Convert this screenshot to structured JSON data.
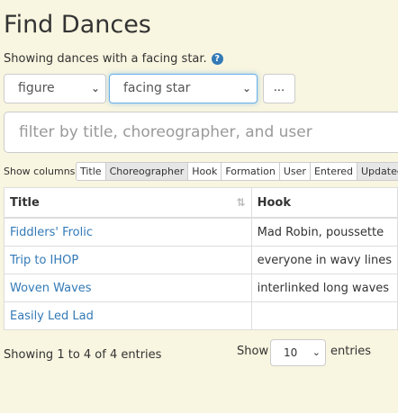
{
  "page": {
    "title": "Find Dances",
    "subtitle": "Showing dances with a facing star.",
    "help_glyph": "?"
  },
  "filter_row": {
    "field_select": "figure",
    "value_select": "facing star",
    "more_button": "..."
  },
  "search": {
    "placeholder": "filter by title, choreographer, and user"
  },
  "columns_toggle": {
    "label": "Show columns",
    "buttons": [
      {
        "label": "Title",
        "active": false
      },
      {
        "label": "Choreographer",
        "active": true
      },
      {
        "label": "Hook",
        "active": false
      },
      {
        "label": "Formation",
        "active": false
      },
      {
        "label": "User",
        "active": false
      },
      {
        "label": "Entered",
        "active": false
      },
      {
        "label": "Updated",
        "active": true
      }
    ]
  },
  "table": {
    "headers": [
      "Title",
      "Hook"
    ],
    "rows": [
      {
        "title": "Fiddlers' Frolic",
        "hook": "Mad Robin, poussette"
      },
      {
        "title": "Trip to IHOP",
        "hook": "everyone in wavy lines"
      },
      {
        "title": "Woven Waves",
        "hook": "interlinked long waves"
      },
      {
        "title": "Easily Led Lad",
        "hook": ""
      }
    ]
  },
  "footer": {
    "info": "Showing 1 to 4 of 4 entries",
    "show_label": "Show",
    "page_length": "10",
    "entries_label": "entries"
  },
  "colors": {
    "background": "#f8f5e0",
    "link": "#337ab7",
    "focus": "#66afe9"
  },
  "icons": [
    "question-circle-icon",
    "chevron-down-icon",
    "sort-icon"
  ]
}
